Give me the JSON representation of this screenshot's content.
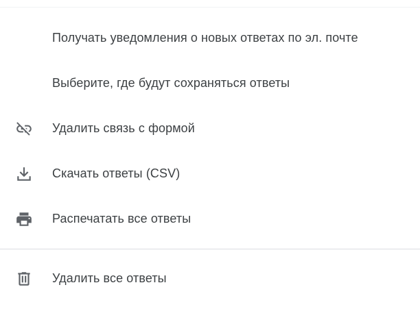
{
  "menu": {
    "items": [
      {
        "label": "Получать уведомления о новых ответах по эл. почте",
        "icon": ""
      },
      {
        "label": "Выберите, где будут сохраняться ответы",
        "icon": ""
      },
      {
        "label": "Удалить связь с формой",
        "icon": "link-off-icon"
      },
      {
        "label": "Скачать ответы (CSV)",
        "icon": "download-icon"
      },
      {
        "label": "Распечатать все ответы",
        "icon": "print-icon"
      },
      {
        "label": "Удалить все ответы",
        "icon": "trash-icon"
      }
    ]
  },
  "colors": {
    "text": "#3c4043",
    "icon": "#5f6368",
    "divider": "#dadce0",
    "background": "#ffffff"
  }
}
